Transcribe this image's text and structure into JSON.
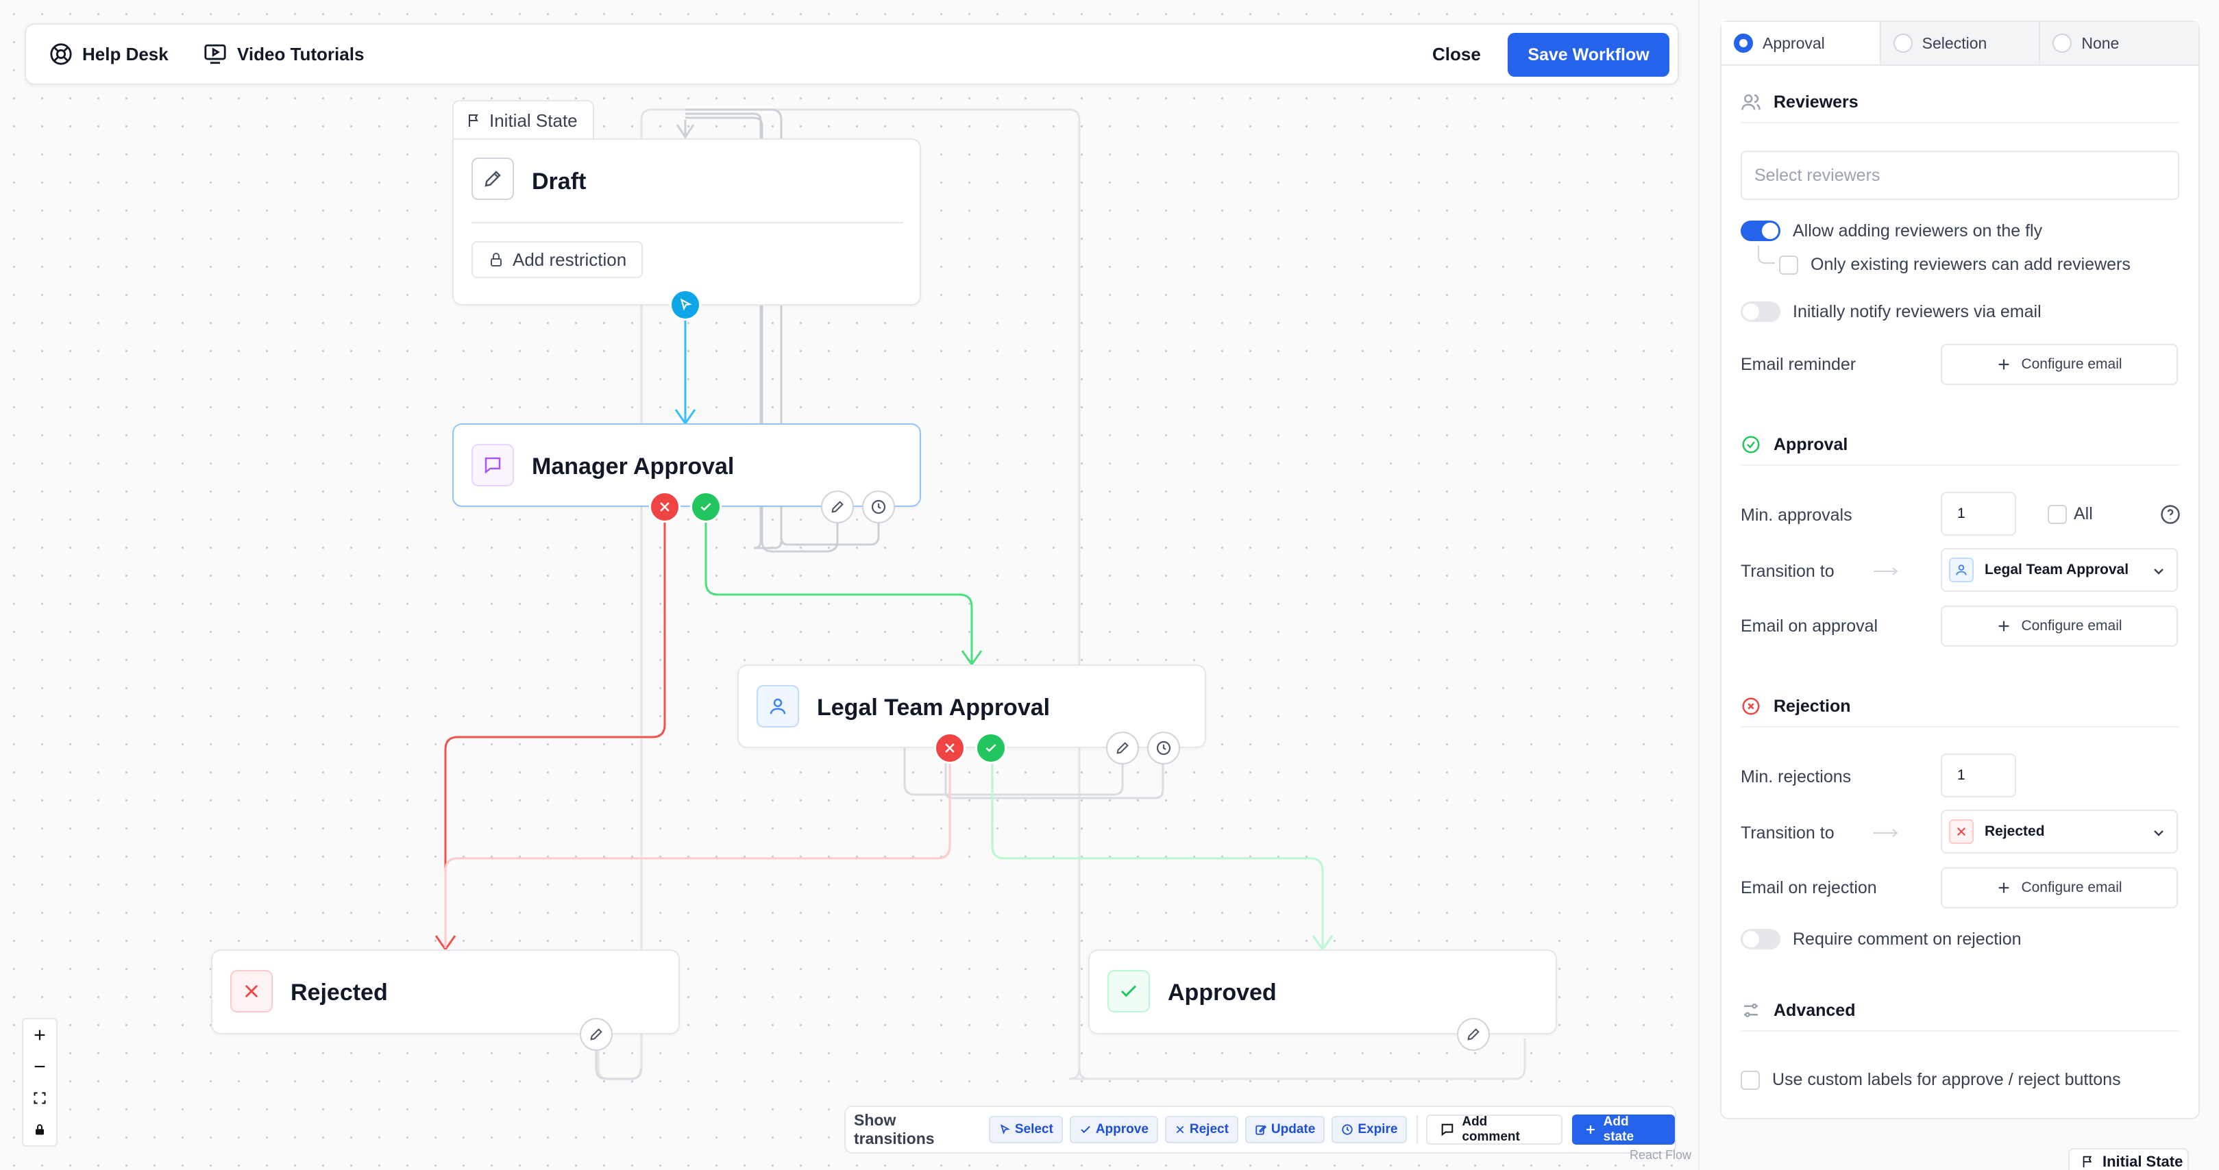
{
  "topbar": {
    "help_desk": "Help Desk",
    "video_tutorials": "Video Tutorials",
    "close": "Close",
    "save": "Save Workflow"
  },
  "nodes": {
    "initial_tag": "Initial State",
    "draft": "Draft",
    "add_restriction": "Add restriction",
    "manager": "Manager Approval",
    "legal": "Legal Team Approval",
    "rejected": "Rejected",
    "approved": "Approved"
  },
  "bottombar": {
    "show_transitions": "Show transitions",
    "chips": [
      "Select",
      "Approve",
      "Reject",
      "Update",
      "Expire"
    ],
    "add_comment": "Add comment",
    "add_state": "Add state"
  },
  "react_flow": "React Flow",
  "panel": {
    "tabs": [
      "Approval",
      "Selection",
      "None"
    ],
    "reviewers": {
      "title": "Reviewers",
      "placeholder": "Select reviewers",
      "allow_fly": "Allow adding reviewers on the fly",
      "only_existing": "Only existing reviewers can add reviewers",
      "notify": "Initially notify reviewers via email",
      "email_reminder": "Email reminder",
      "configure_email": "Configure email"
    },
    "approval": {
      "title": "Approval",
      "min_label": "Min. approvals",
      "min_value": "1",
      "all": "All",
      "transition_label": "Transition to",
      "transition_value": "Legal Team Approval",
      "email_label": "Email on approval",
      "configure_email": "Configure email"
    },
    "rejection": {
      "title": "Rejection",
      "min_label": "Min. rejections",
      "min_value": "1",
      "transition_label": "Transition to",
      "transition_value": "Rejected",
      "email_label": "Email on rejection",
      "configure_email": "Configure email",
      "require_comment": "Require comment on rejection"
    },
    "advanced": {
      "title": "Advanced",
      "custom_labels": "Use custom labels for approve / reject buttons"
    }
  },
  "initial_state_footer": "Initial State",
  "colors": {
    "primary": "#2563eb",
    "reject": "#ef4444",
    "approve": "#22c55e",
    "select": "#0ea5e9"
  }
}
